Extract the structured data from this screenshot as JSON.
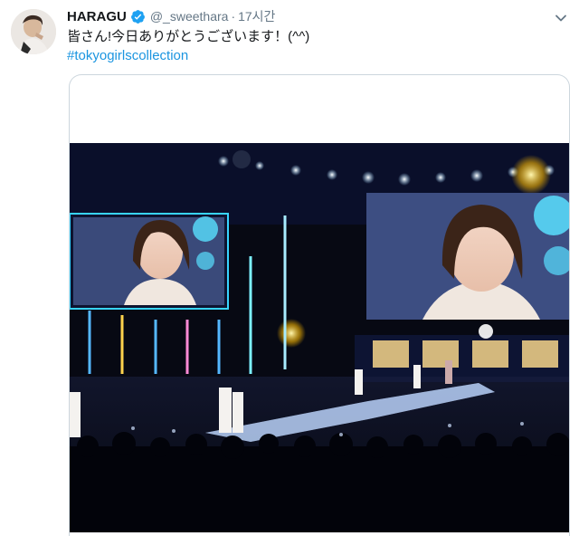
{
  "tweet": {
    "display_name": "HARAGU",
    "handle": "@_sweethara",
    "separator": "·",
    "timestamp": "17시간",
    "text": "皆さん!今日ありがとうございます！(^^)",
    "hashtag": "#tokyogirlscollection"
  },
  "icons": {
    "verified": "verified-badge-icon",
    "menu": "chevron-down-icon"
  },
  "colors": {
    "accent": "#1b95e0",
    "secondary_text": "#657786",
    "verified": "#1da1f2"
  }
}
